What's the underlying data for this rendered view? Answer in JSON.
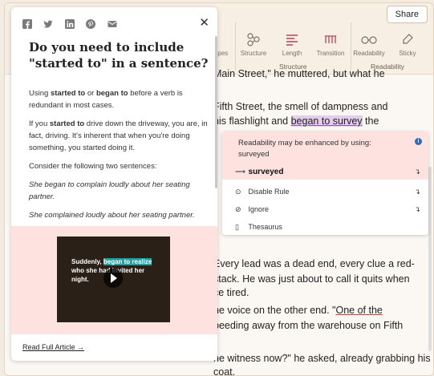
{
  "header": {
    "share_label": "Share"
  },
  "toolbar": {
    "tools": [
      {
        "label": "Tropes"
      },
      {
        "label": "Structure"
      },
      {
        "label": "Length"
      },
      {
        "label": "Transition"
      },
      {
        "label": "Readability"
      },
      {
        "label": "Sticky"
      }
    ],
    "groups": {
      "structure": "Structure",
      "readability": "Readability"
    }
  },
  "document": {
    "lines": [
      "Main Street,\" he muttered, but what he",
      "Fifth Street, the smell of dampness and",
      "his flashlight and",
      "began to survey",
      "the",
      "Every lead was a dead end, every clue a red-",
      "stack. He was just about to call it quits when",
      "ce tired.",
      "he voice on the other end. \"",
      "One of the",
      "peeding away from the warehouse on Fifth",
      "he witness now?\" he asked, already grabbing his",
      "coat."
    ]
  },
  "article": {
    "title": "Do you need to include \"started to\" in a sentence?",
    "p1_a": "Using ",
    "p1_b": "started to",
    "p1_c": " or ",
    "p1_d": "began to",
    "p1_e": " before a verb is redundant in most cases.",
    "p2_a": "If you ",
    "p2_b": "started to",
    "p2_c": " drive down the driveway, you are, in fact, driving. It's inherent that when you're doing something, you started doing it.",
    "p3": "Consider the following two sentences:",
    "ex1": "She began to complain loudly about her seating partner.",
    "ex2": "She complained loudly about her seating partner.",
    "video_text_a": "Suddenly, ",
    "video_text_b": "began to realize",
    "video_text_c": " who she had invited her night.",
    "read_more": "Read Full Article"
  },
  "suggestion": {
    "message": "Readability may be enhanced by using: surveyed",
    "replacement": "surveyed",
    "disable": "Disable Rule",
    "ignore": "Ignore",
    "thesaurus": "Thesaurus"
  },
  "colors": {
    "highlight": "#e4cdec",
    "accent": "#b5455a",
    "card_bg": "#fde2df"
  }
}
